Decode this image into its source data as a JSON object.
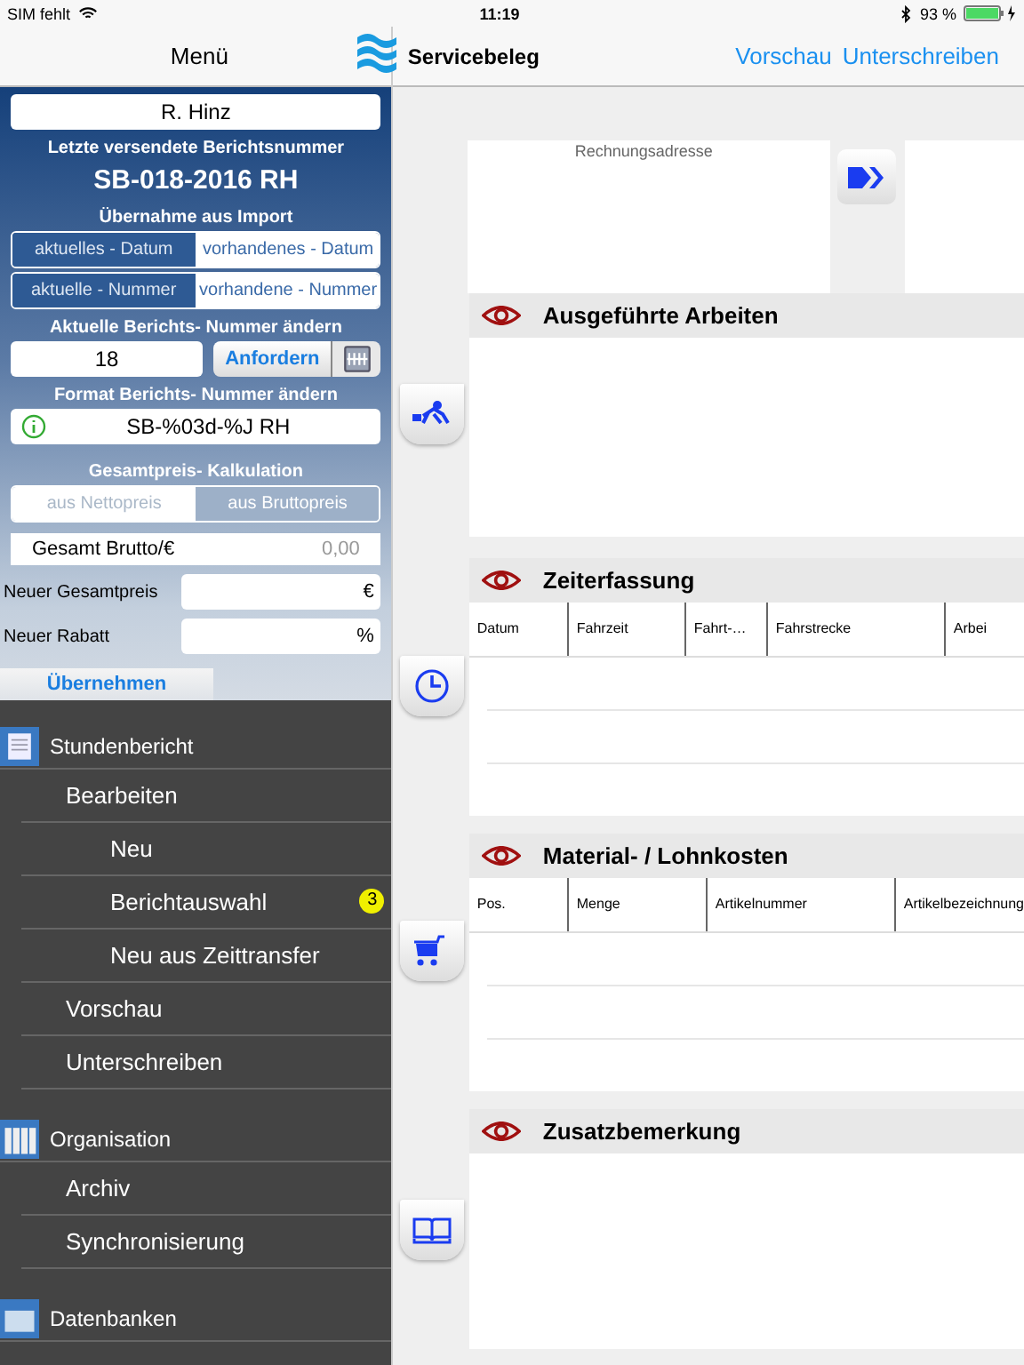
{
  "status_bar": {
    "carrier": "SIM fehlt",
    "time": "11:19",
    "battery": "93 %"
  },
  "menu_header": {
    "title": "Menü"
  },
  "panel": {
    "user": "R. Hinz",
    "last_number_label": "Letzte versendete Berichtsnummer",
    "last_number": "SB-018-2016 RH",
    "import_label": "Übernahme aus Import",
    "import_date_options": [
      {
        "label": "aktuelles - Datum",
        "selected": true
      },
      {
        "label": "vorhandenes - Datum",
        "selected": false
      }
    ],
    "import_number_options": [
      {
        "label": "aktuelle - Nummer",
        "selected": true
      },
      {
        "label": "vorhandene - Nummer",
        "selected": false
      }
    ],
    "change_number_label": "Aktuelle Berichts- Nummer ändern",
    "number_value": "18",
    "request_button": "Anfordern",
    "format_label": "Format Berichts- Nummer ändern",
    "format_value": "SB-%03d-%J RH",
    "price_label": "Gesamtpreis- Kalkulation",
    "price_options": [
      {
        "label": "aus Nettopreis",
        "selected": false
      },
      {
        "label": "aus Bruttopreis",
        "selected": true
      }
    ],
    "gross_label": "Gesamt Brutto/€",
    "gross_value": "0,00",
    "new_total_label": "Neuer Gesamtpreis",
    "new_total_unit": "€",
    "new_discount_label": "Neuer Rabatt",
    "new_discount_unit": "%",
    "apply_button": "Übernehmen"
  },
  "menu": [
    {
      "title": "Stundenbericht",
      "items": [
        {
          "label": "Bearbeiten",
          "children": [
            {
              "label": "Neu"
            },
            {
              "label": "Berichtauswahl",
              "badge": "3"
            },
            {
              "label": "Neu aus Zeittransfer"
            }
          ]
        },
        {
          "label": "Vorschau"
        },
        {
          "label": "Unterschreiben"
        }
      ]
    },
    {
      "title": "Organisation",
      "items": [
        {
          "label": "Archiv"
        },
        {
          "label": "Synchronisierung"
        }
      ]
    },
    {
      "title": "Datenbanken"
    }
  ],
  "nav": {
    "title": "Servicebeleg",
    "actions": [
      "Vorschau",
      "Unterschreiben"
    ]
  },
  "billing_address": {
    "label": "Rechnungsadresse"
  },
  "sections": [
    {
      "title": "Ausgeführte Arbeiten",
      "kind": "text"
    },
    {
      "title": "Zeiterfassung",
      "kind": "table",
      "columns": [
        "Datum",
        "Fahrzeit",
        "Fahrt-…",
        "Fahrstrecke",
        "Arbei"
      ]
    },
    {
      "title": "Material- / Lohnkosten",
      "kind": "table",
      "columns": [
        "Pos.",
        "Menge",
        "Artikelnummer",
        "Artikelbezeichnung"
      ]
    },
    {
      "title": "Zusatzbemerkung",
      "kind": "text"
    }
  ]
}
